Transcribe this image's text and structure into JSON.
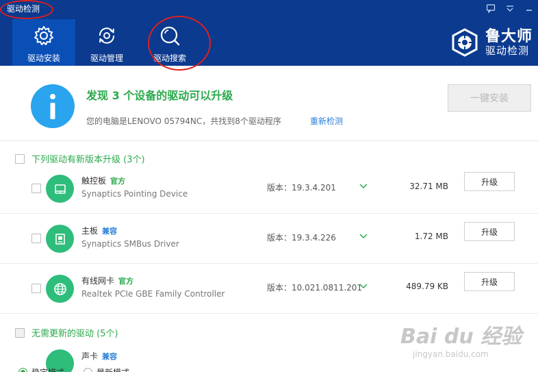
{
  "window": {
    "title": "驱动检测"
  },
  "nav": [
    {
      "label": "驱动安装",
      "icon": "gear-icon"
    },
    {
      "label": "驱动管理",
      "icon": "refresh-gear-icon"
    },
    {
      "label": "驱动搜索",
      "icon": "search-icon"
    }
  ],
  "brand": {
    "name": "鲁大师",
    "sub": "驱动检测"
  },
  "summary": {
    "headline": "发现 3 个设备的驱动可以升级",
    "detail": "您的电脑是LENOVO 05794NC，共找到8个驱动程序",
    "rescan": "重新检测",
    "install_all": "一键安装"
  },
  "groups": {
    "upgradable_label": "下列驱动有新版本升级 (3个)",
    "noupdate_label": "无需更新的驱动 (5个)"
  },
  "drivers": [
    {
      "name": "触控板",
      "tag": "官方",
      "desc": "Synaptics Pointing Device",
      "version": "版本：19.3.4.201",
      "size": "32.71 MB",
      "action": "升级",
      "icon": "touchpad-icon"
    },
    {
      "name": "主板",
      "tag": "兼容",
      "desc": "Synaptics SMBus Driver",
      "version": "版本：19.3.4.226",
      "size": "1.72 MB",
      "action": "升级",
      "icon": "motherboard-icon"
    },
    {
      "name": "有线网卡",
      "tag": "官方",
      "desc": "Realtek PCIe GBE Family Controller",
      "version": "版本：10.021.0811.201",
      "size": "489.79 KB",
      "action": "升级",
      "icon": "globe-icon"
    }
  ],
  "partial": {
    "name": "声卡",
    "tag": "兼容"
  },
  "modes": [
    "稳定模式",
    "最新模式"
  ],
  "watermark": {
    "main": "Bai du 经验",
    "sub": "jingyan.baidu.com"
  },
  "colors": {
    "header": "#0b3a8e",
    "accent_green": "#2aa94b",
    "tag_official": "#2aa94b",
    "tag_compatible": "#2a7fd8",
    "link": "#2a7fd8",
    "annotation": "#e0201b"
  }
}
